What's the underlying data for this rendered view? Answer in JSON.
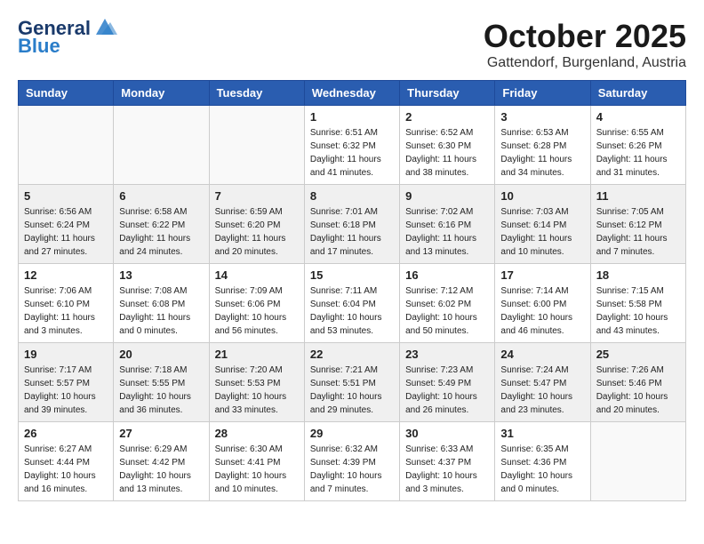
{
  "header": {
    "logo": {
      "general": "General",
      "blue": "Blue"
    },
    "month": "October 2025",
    "location": "Gattendorf, Burgenland, Austria"
  },
  "days_of_week": [
    "Sunday",
    "Monday",
    "Tuesday",
    "Wednesday",
    "Thursday",
    "Friday",
    "Saturday"
  ],
  "weeks": [
    [
      {
        "day": "",
        "info": ""
      },
      {
        "day": "",
        "info": ""
      },
      {
        "day": "",
        "info": ""
      },
      {
        "day": "1",
        "info": "Sunrise: 6:51 AM\nSunset: 6:32 PM\nDaylight: 11 hours\nand 41 minutes."
      },
      {
        "day": "2",
        "info": "Sunrise: 6:52 AM\nSunset: 6:30 PM\nDaylight: 11 hours\nand 38 minutes."
      },
      {
        "day": "3",
        "info": "Sunrise: 6:53 AM\nSunset: 6:28 PM\nDaylight: 11 hours\nand 34 minutes."
      },
      {
        "day": "4",
        "info": "Sunrise: 6:55 AM\nSunset: 6:26 PM\nDaylight: 11 hours\nand 31 minutes."
      }
    ],
    [
      {
        "day": "5",
        "info": "Sunrise: 6:56 AM\nSunset: 6:24 PM\nDaylight: 11 hours\nand 27 minutes."
      },
      {
        "day": "6",
        "info": "Sunrise: 6:58 AM\nSunset: 6:22 PM\nDaylight: 11 hours\nand 24 minutes."
      },
      {
        "day": "7",
        "info": "Sunrise: 6:59 AM\nSunset: 6:20 PM\nDaylight: 11 hours\nand 20 minutes."
      },
      {
        "day": "8",
        "info": "Sunrise: 7:01 AM\nSunset: 6:18 PM\nDaylight: 11 hours\nand 17 minutes."
      },
      {
        "day": "9",
        "info": "Sunrise: 7:02 AM\nSunset: 6:16 PM\nDaylight: 11 hours\nand 13 minutes."
      },
      {
        "day": "10",
        "info": "Sunrise: 7:03 AM\nSunset: 6:14 PM\nDaylight: 11 hours\nand 10 minutes."
      },
      {
        "day": "11",
        "info": "Sunrise: 7:05 AM\nSunset: 6:12 PM\nDaylight: 11 hours\nand 7 minutes."
      }
    ],
    [
      {
        "day": "12",
        "info": "Sunrise: 7:06 AM\nSunset: 6:10 PM\nDaylight: 11 hours\nand 3 minutes."
      },
      {
        "day": "13",
        "info": "Sunrise: 7:08 AM\nSunset: 6:08 PM\nDaylight: 11 hours\nand 0 minutes."
      },
      {
        "day": "14",
        "info": "Sunrise: 7:09 AM\nSunset: 6:06 PM\nDaylight: 10 hours\nand 56 minutes."
      },
      {
        "day": "15",
        "info": "Sunrise: 7:11 AM\nSunset: 6:04 PM\nDaylight: 10 hours\nand 53 minutes."
      },
      {
        "day": "16",
        "info": "Sunrise: 7:12 AM\nSunset: 6:02 PM\nDaylight: 10 hours\nand 50 minutes."
      },
      {
        "day": "17",
        "info": "Sunrise: 7:14 AM\nSunset: 6:00 PM\nDaylight: 10 hours\nand 46 minutes."
      },
      {
        "day": "18",
        "info": "Sunrise: 7:15 AM\nSunset: 5:58 PM\nDaylight: 10 hours\nand 43 minutes."
      }
    ],
    [
      {
        "day": "19",
        "info": "Sunrise: 7:17 AM\nSunset: 5:57 PM\nDaylight: 10 hours\nand 39 minutes."
      },
      {
        "day": "20",
        "info": "Sunrise: 7:18 AM\nSunset: 5:55 PM\nDaylight: 10 hours\nand 36 minutes."
      },
      {
        "day": "21",
        "info": "Sunrise: 7:20 AM\nSunset: 5:53 PM\nDaylight: 10 hours\nand 33 minutes."
      },
      {
        "day": "22",
        "info": "Sunrise: 7:21 AM\nSunset: 5:51 PM\nDaylight: 10 hours\nand 29 minutes."
      },
      {
        "day": "23",
        "info": "Sunrise: 7:23 AM\nSunset: 5:49 PM\nDaylight: 10 hours\nand 26 minutes."
      },
      {
        "day": "24",
        "info": "Sunrise: 7:24 AM\nSunset: 5:47 PM\nDaylight: 10 hours\nand 23 minutes."
      },
      {
        "day": "25",
        "info": "Sunrise: 7:26 AM\nSunset: 5:46 PM\nDaylight: 10 hours\nand 20 minutes."
      }
    ],
    [
      {
        "day": "26",
        "info": "Sunrise: 6:27 AM\nSunset: 4:44 PM\nDaylight: 10 hours\nand 16 minutes."
      },
      {
        "day": "27",
        "info": "Sunrise: 6:29 AM\nSunset: 4:42 PM\nDaylight: 10 hours\nand 13 minutes."
      },
      {
        "day": "28",
        "info": "Sunrise: 6:30 AM\nSunset: 4:41 PM\nDaylight: 10 hours\nand 10 minutes."
      },
      {
        "day": "29",
        "info": "Sunrise: 6:32 AM\nSunset: 4:39 PM\nDaylight: 10 hours\nand 7 minutes."
      },
      {
        "day": "30",
        "info": "Sunrise: 6:33 AM\nSunset: 4:37 PM\nDaylight: 10 hours\nand 3 minutes."
      },
      {
        "day": "31",
        "info": "Sunrise: 6:35 AM\nSunset: 4:36 PM\nDaylight: 10 hours\nand 0 minutes."
      },
      {
        "day": "",
        "info": ""
      }
    ]
  ],
  "row_shaded": [
    false,
    true,
    false,
    true,
    false
  ]
}
